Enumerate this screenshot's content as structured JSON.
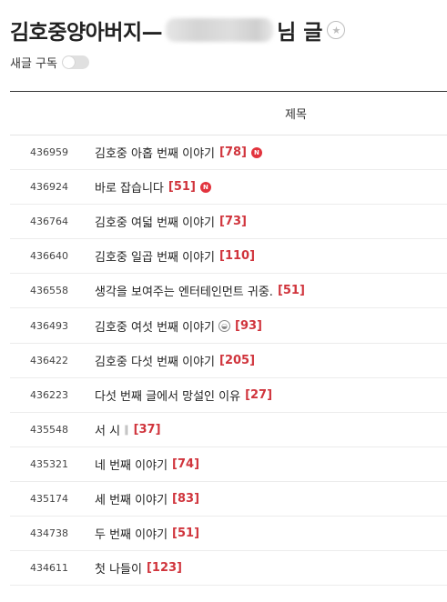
{
  "header": {
    "title_prefix": "김호중양아버지—",
    "title_suffix": "님 글",
    "star_icon": "star-icon"
  },
  "subscribe": {
    "label": "새글 구독",
    "enabled": false
  },
  "table": {
    "column_title": "제목",
    "rows": [
      {
        "num": "436959",
        "title": "김호중 아홉 번째 이야기",
        "count": "[78]",
        "icon": "new"
      },
      {
        "num": "436924",
        "title": "바로 잡습니다",
        "count": "[51]",
        "icon": "new"
      },
      {
        "num": "436764",
        "title": "김호중 여덟 번째 이야기",
        "count": "[73]",
        "icon": ""
      },
      {
        "num": "436640",
        "title": "김호중 일곱 번째 이야기",
        "count": "[110]",
        "icon": ""
      },
      {
        "num": "436558",
        "title": "생각을 보여주는 엔터테인먼트 귀중.",
        "count": "[51]",
        "icon": ""
      },
      {
        "num": "436493",
        "title": "김호중 여섯 번째 이야기",
        "count": "[93]",
        "icon": "image"
      },
      {
        "num": "436422",
        "title": "김호중 다섯 번째 이야기",
        "count": "[205]",
        "icon": ""
      },
      {
        "num": "436223",
        "title": "다섯 번째 글에서 망설인 이유",
        "count": "[27]",
        "icon": ""
      },
      {
        "num": "435548",
        "title": "서 시",
        "count": "[37]",
        "icon": "attachment"
      },
      {
        "num": "435321",
        "title": "네 번째 이야기",
        "count": "[74]",
        "icon": ""
      },
      {
        "num": "435174",
        "title": "세 번째 이야기",
        "count": "[83]",
        "icon": ""
      },
      {
        "num": "434738",
        "title": "두 번째 이야기",
        "count": "[51]",
        "icon": ""
      },
      {
        "num": "434611",
        "title": "첫 나들이",
        "count": "[123]",
        "icon": ""
      }
    ]
  },
  "colors": {
    "count": "#d0343c",
    "new_badge": "#e2333d",
    "divider": "#333333"
  },
  "icons": {
    "new_label": "N",
    "image_glyph": "◒",
    "attachment_glyph": "📎"
  }
}
